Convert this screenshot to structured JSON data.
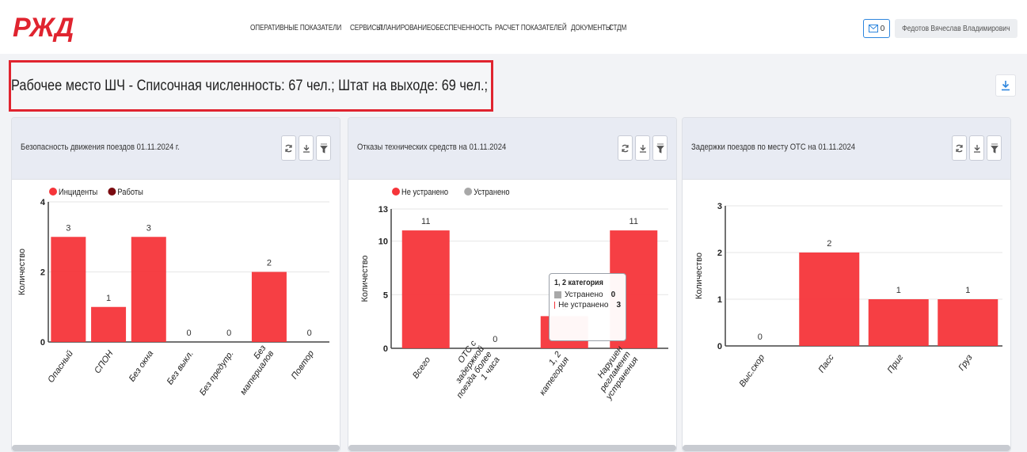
{
  "header": {
    "logo_text": "РЖД",
    "nav": [
      "ОПЕРАТИВНЫЕ ПОКАЗАТЕЛИ",
      "СЕРВИСЫ",
      "ПЛАНИРОВАНИЕ",
      "ОБЕСПЕЧЕННОСТЬ",
      "РАСЧЕТ ПОКАЗАТЕЛЕЙ",
      "ДОКУМЕНТЫ",
      "СТДМ"
    ],
    "mail_count": "0",
    "mail_icon": "envelope-icon",
    "user_name": "Федотов Вячеслав Владимирович"
  },
  "page": {
    "title": "Рабочее место ШЧ - Списочная численность: 67 чел.; Штат на выходе: 69 чел.;",
    "download_icon": "download-icon"
  },
  "colors": {
    "accent": "#2e86de",
    "brand": "#e0242f",
    "bar": "#f6353a",
    "bar_dark": "#7a0b10",
    "grey": "#a8a8a8"
  },
  "panels": [
    {
      "title": "Безопасность движения поездов 01.11.2024 г.",
      "tools": [
        "refresh-icon",
        "download-icon",
        "filter-icon"
      ]
    },
    {
      "title": "Отказы технических средств на 01.11.2024",
      "tools": [
        "refresh-icon",
        "download-icon",
        "filter-icon"
      ],
      "tooltip": {
        "title": "1, 2 категория",
        "rows": [
          {
            "label": "Устранено",
            "value": "0"
          },
          {
            "label": "Не устранено",
            "value": "3"
          }
        ]
      }
    },
    {
      "title": "Задержки поездов по месту ОТС на 01.11.2024",
      "tools": [
        "refresh-icon",
        "download-icon",
        "filter-icon"
      ]
    }
  ],
  "chart_data": [
    {
      "type": "bar",
      "ylabel": "Количество",
      "ylim": [
        0,
        4
      ],
      "yticks": [
        0,
        2,
        4
      ],
      "legend": [
        "Инциденты",
        "Работы"
      ],
      "categories": [
        "Опасный",
        "СПОН",
        "Без окна",
        "Без выкл.",
        "Без предупр.",
        "Без материалов",
        "Повтор"
      ],
      "series": [
        {
          "name": "Инциденты",
          "values": [
            3,
            1,
            3,
            0,
            0,
            2,
            0
          ]
        }
      ]
    },
    {
      "type": "bar",
      "ylabel": "Количество",
      "ylim": [
        0,
        13
      ],
      "yticks": [
        0,
        5,
        10,
        13
      ],
      "legend": [
        "Не устранено",
        "Устранено"
      ],
      "categories": [
        "Всего",
        "ОТС с задержкой поезда более 1 часа",
        "1, 2 категория",
        "Нарушен регламент устранения"
      ],
      "series": [
        {
          "name": "Не устранено",
          "values": [
            11,
            0,
            3,
            11
          ]
        }
      ]
    },
    {
      "type": "bar",
      "ylabel": "Количество",
      "ylim": [
        0,
        3
      ],
      "yticks": [
        0,
        1,
        2,
        3
      ],
      "categories": [
        "Выс.скор",
        "Пасс",
        "Приг",
        "Груз"
      ],
      "series": [
        {
          "name": "",
          "values": [
            0,
            2,
            1,
            1
          ]
        }
      ]
    }
  ]
}
